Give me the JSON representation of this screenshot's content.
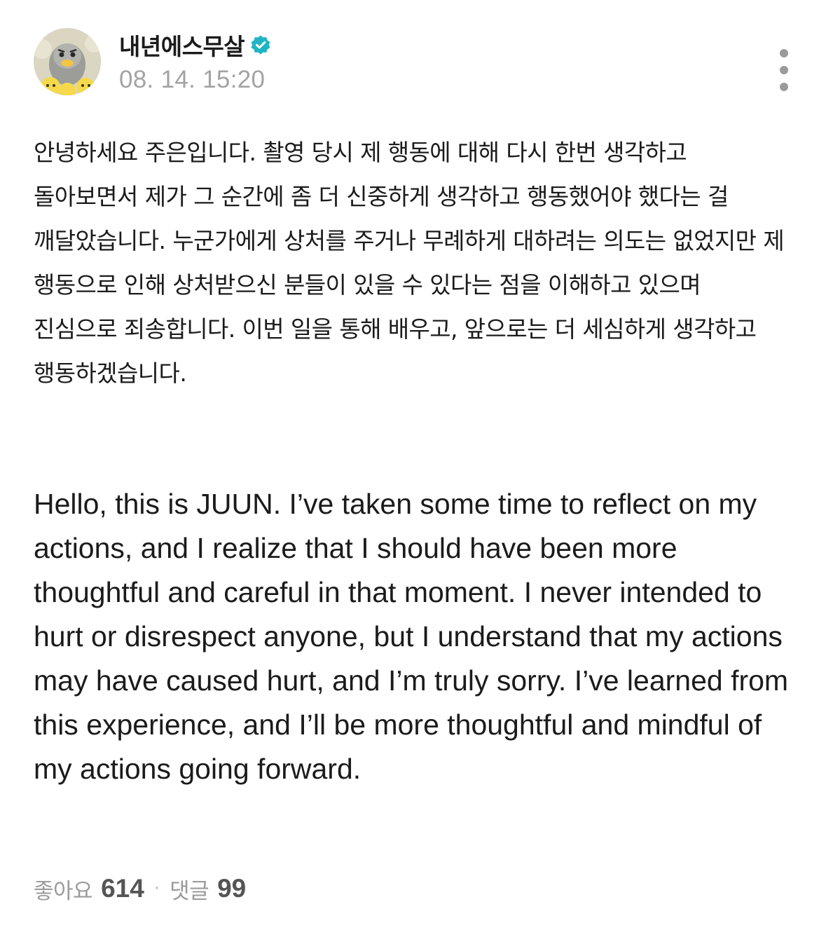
{
  "post": {
    "author": {
      "name": "내년에스무살",
      "verified_icon": "verified-badge-icon",
      "badge_color": "#1fb5c3"
    },
    "timestamp": "08. 14. 15:20",
    "menu_icon": "more-vertical-icon",
    "body_ko": "안녕하세요 주은입니다. 촬영 당시 제 행동에 대해 다시 한번 생각하고 돌아보면서 제가 그 순간에 좀 더 신중하게 생각하고 행동했어야 했다는 걸 깨달았습니다. 누군가에게 상처를 주거나 무례하게 대하려는 의도는 없었지만 제 행동으로 인해 상처받으신 분들이 있을 수 있다는 점을 이해하고 있으며 진심으로 죄송합니다. 이번 일을 통해 배우고, 앞으로는 더 세심하게 생각하고 행동하겠습니다.",
    "body_en": "Hello, this is JUUN. I’ve taken some time to reflect on my actions, and I realize that I should have been more thoughtful and careful in that moment. I never intended to hurt or disrespect anyone, but I understand that my actions may have caused hurt, and I’m truly sorry. I’ve learned from this experience, and I’ll be more thoughtful and mindful of my actions going forward.",
    "footer": {
      "likes_label": "좋아요",
      "likes_count": "614",
      "separator": "·",
      "comments_label": "댓글",
      "comments_count": "99"
    }
  }
}
